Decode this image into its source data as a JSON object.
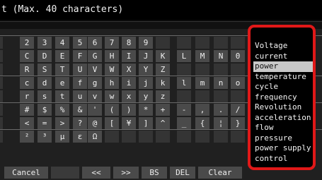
{
  "title": "t (Max. 40 characters)",
  "keys": {
    "r0": [
      "2",
      "3",
      "4",
      "5",
      "6",
      "7",
      "8",
      "9"
    ],
    "r1": [
      "C",
      "D",
      "E",
      "F",
      "G",
      "H",
      "I",
      "J",
      "K",
      "L",
      "M",
      "N",
      "0"
    ],
    "r2": [
      "R",
      "S",
      "T",
      "U",
      "V",
      "W",
      "X",
      "Y",
      "Z"
    ],
    "r3": [
      "c",
      "d",
      "e",
      "f",
      "g",
      "h",
      "i",
      "j",
      "k",
      "l",
      "m",
      "n",
      "o"
    ],
    "r4": [
      "r",
      "s",
      "t",
      "u",
      "v",
      "w",
      "x",
      "y",
      "z"
    ],
    "r5": [
      "#",
      "$",
      "%",
      "&",
      "'",
      "(",
      ")",
      "*",
      "+",
      "-",
      ",",
      ".",
      "/"
    ],
    "r6": [
      "<",
      "=",
      ">",
      "?",
      "@",
      "[",
      "¥",
      "]",
      "^",
      "_",
      "{",
      "¦",
      "}"
    ],
    "r7": [
      "²",
      "³",
      "μ",
      "ε",
      "Ω"
    ]
  },
  "bottom": {
    "cancel": "Cancel",
    "left": "<<",
    "right": ">>",
    "bs": "BS",
    "del": "DEL",
    "clear": "Clear"
  },
  "popup": {
    "items": [
      "Voltage",
      "current",
      "power",
      "temperature",
      "cycle",
      "frequency",
      "Revolution",
      "acceleration",
      "flow",
      "pressure",
      "power supply",
      "control"
    ],
    "selected_index": 2
  },
  "colors": {
    "highlight_border": "#e01818"
  }
}
